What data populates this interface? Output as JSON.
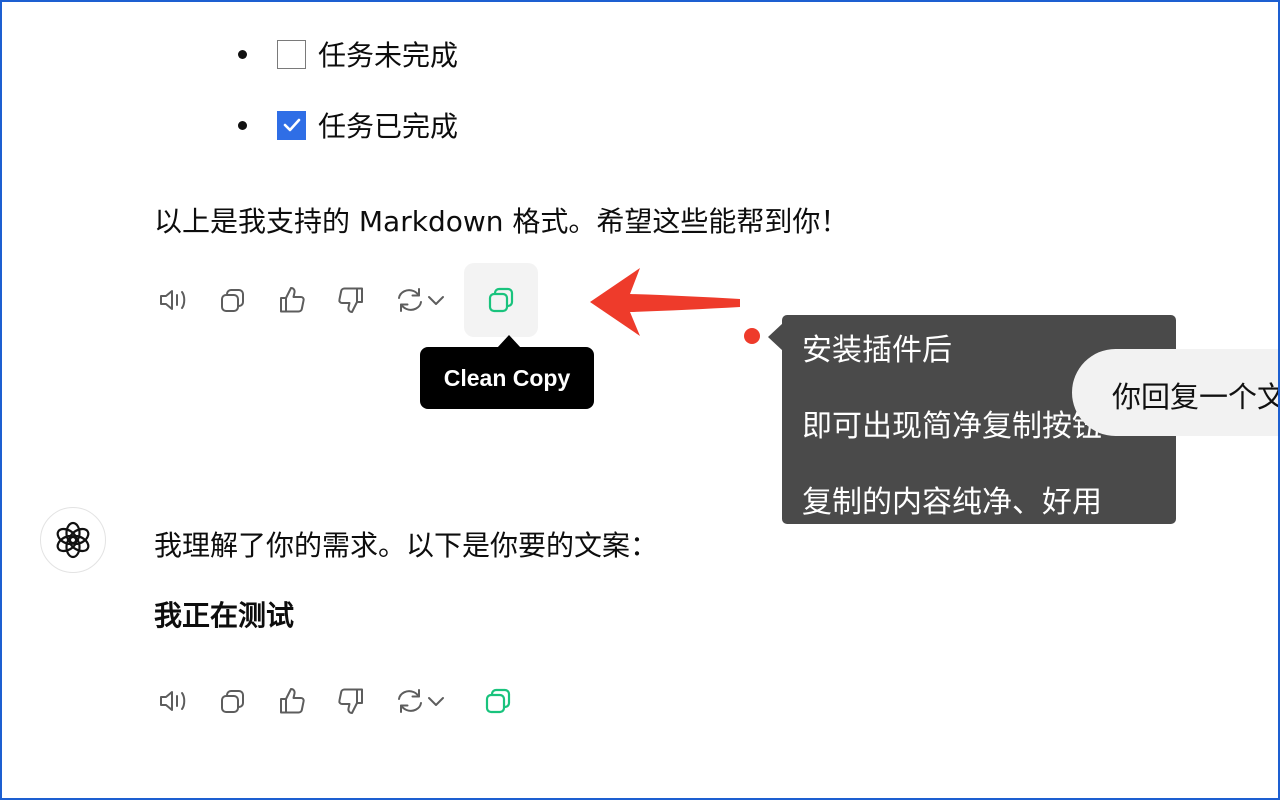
{
  "task_list": [
    {
      "label": "任务未完成",
      "checked": false
    },
    {
      "label": "任务已完成",
      "checked": true
    }
  ],
  "message1": {
    "text": "以上是我支持的 Markdown 格式。希望这些能帮到你！"
  },
  "message2": {
    "intro": "我理解了你的需求。以下是你要的文案：",
    "heading": "我正在测试"
  },
  "actions": {
    "icons": [
      "speaker-icon",
      "copy-icon",
      "thumbs-up-icon",
      "thumbs-down-icon",
      "regenerate-icon",
      "chevron-down-icon",
      "clean-copy-icon"
    ]
  },
  "tooltip": {
    "label": "Clean Copy"
  },
  "promo": {
    "lines": [
      "安装插件后",
      "即可出现简净复制按钮",
      "复制的内容纯净、好用"
    ]
  },
  "user_bubble": {
    "text": "你回复一个文"
  },
  "colors": {
    "accent_green": "#19c37d",
    "arrow_red": "#ee3b2b",
    "checkbox_blue": "#2f6ee6",
    "frame_blue": "#1d5fd1"
  }
}
